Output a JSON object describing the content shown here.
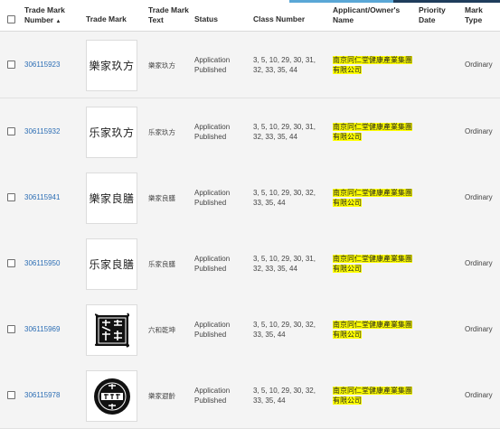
{
  "topbar_colors": [
    "#5aa7d6",
    "#1f3d5c"
  ],
  "headers": {
    "trade_mark_number": "Trade Mark Number",
    "sort_indicator": "▲",
    "trade_mark": "Trade Mark",
    "trade_mark_text": "Trade Mark Text",
    "status": "Status",
    "class_number": "Class Number",
    "owner": "Applicant/Owner's Name",
    "priority_date": "Priority Date",
    "mark_type": "Mark Type"
  },
  "rows": [
    {
      "number": "306115923",
      "image_text": "樂家玖方",
      "text": "樂家玖方",
      "status": "Application Published",
      "classes": "3, 5, 10, 29, 30, 31, 32, 33, 35, 44",
      "owner": "南京同仁堂健康產業集團有限公司",
      "priority_date": "",
      "type": "Ordinary"
    },
    {
      "number": "306115932",
      "image_text": "乐家玖方",
      "text": "乐家玖方",
      "status": "Application Published",
      "classes": "3, 5, 10, 29, 30, 31, 32, 33, 35, 44",
      "owner": "南京同仁堂健康產業集團有限公司",
      "priority_date": "",
      "type": "Ordinary"
    },
    {
      "number": "306115941",
      "image_text": "樂家良膳",
      "text": "樂家良膳",
      "status": "Application Published",
      "classes": "3, 5, 10, 29, 30, 32, 33, 35, 44",
      "owner": "南京同仁堂健康產業集團有限公司",
      "priority_date": "",
      "type": "Ordinary"
    },
    {
      "number": "306115950",
      "image_text": "乐家良膳",
      "text": "乐家良膳",
      "status": "Application Published",
      "classes": "3, 5, 10, 29, 30, 31, 32, 33, 35, 44",
      "owner": "南京同仁堂健康產業集團有限公司",
      "priority_date": "",
      "type": "Ordinary"
    },
    {
      "number": "306115969",
      "image_text": "",
      "text": "六和乾坤",
      "status": "Application Published",
      "classes": "3, 5, 10, 29, 30, 32, 33, 35, 44",
      "owner": "南京同仁堂健康產業集團有限公司",
      "priority_date": "",
      "type": "Ordinary"
    },
    {
      "number": "306115978",
      "image_text": "",
      "text": "樂家遐齡",
      "status": "Application Published",
      "classes": "3, 5, 10, 29, 30, 32, 33, 35, 44",
      "owner": "南京同仁堂健康產業集團有限公司",
      "priority_date": "",
      "type": "Ordinary"
    }
  ]
}
